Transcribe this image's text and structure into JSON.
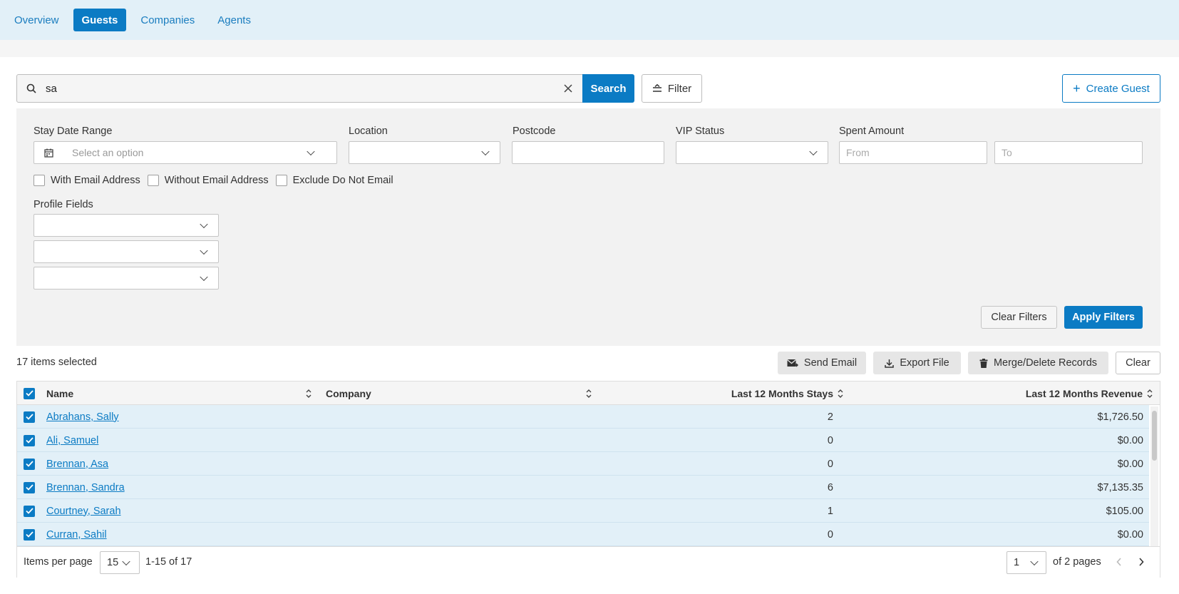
{
  "nav": {
    "tabs": [
      {
        "label": "Overview",
        "active": false
      },
      {
        "label": "Guests",
        "active": true
      },
      {
        "label": "Companies",
        "active": false
      },
      {
        "label": "Agents",
        "active": false
      }
    ]
  },
  "search": {
    "value": "sa",
    "search_label": "Search",
    "filter_label": "Filter",
    "create_label": "Create Guest"
  },
  "filters": {
    "stay_date_range": {
      "label": "Stay Date Range",
      "placeholder": "Select an option"
    },
    "location": {
      "label": "Location",
      "value": ""
    },
    "postcode": {
      "label": "Postcode",
      "value": ""
    },
    "vip_status": {
      "label": "VIP Status",
      "value": ""
    },
    "spent_amount": {
      "label": "Spent Amount",
      "from_placeholder": "From",
      "to_placeholder": "To"
    },
    "checkboxes": [
      {
        "label": "With Email Address",
        "checked": false
      },
      {
        "label": "Without Email Address",
        "checked": false
      },
      {
        "label": "Exclude Do Not Email",
        "checked": false
      }
    ],
    "profile_fields": {
      "label": "Profile Fields",
      "values": [
        "",
        "",
        ""
      ]
    },
    "clear_label": "Clear Filters",
    "apply_label": "Apply Filters"
  },
  "selection": {
    "count_text": "17 items selected",
    "send_email_label": "Send Email",
    "export_label": "Export File",
    "merge_label": "Merge/Delete Records",
    "clear_label": "Clear"
  },
  "table": {
    "columns": {
      "name": "Name",
      "company": "Company",
      "stays": "Last 12 Months Stays",
      "revenue": "Last 12 Months Revenue"
    },
    "rows": [
      {
        "name": "Abrahans, Sally",
        "company": "",
        "stays": "2",
        "revenue": "$1,726.50"
      },
      {
        "name": "Ali, Samuel",
        "company": "",
        "stays": "0",
        "revenue": "$0.00"
      },
      {
        "name": "Brennan, Asa",
        "company": "",
        "stays": "0",
        "revenue": "$0.00"
      },
      {
        "name": "Brennan, Sandra",
        "company": "",
        "stays": "6",
        "revenue": "$7,135.35"
      },
      {
        "name": "Courtney, Sarah",
        "company": "",
        "stays": "1",
        "revenue": "$105.00"
      },
      {
        "name": "Curran, Sahil",
        "company": "",
        "stays": "0",
        "revenue": "$0.00"
      }
    ]
  },
  "pagination": {
    "items_per_page_label": "Items per page",
    "items_per_page": "15",
    "range_text": "1-15 of 17",
    "current_page": "1",
    "pages_text": "of 2 pages"
  },
  "colors": {
    "primary": "#0b7bc4",
    "nav_bg": "#e2f0f8",
    "row_selected": "#e2f0f8"
  }
}
